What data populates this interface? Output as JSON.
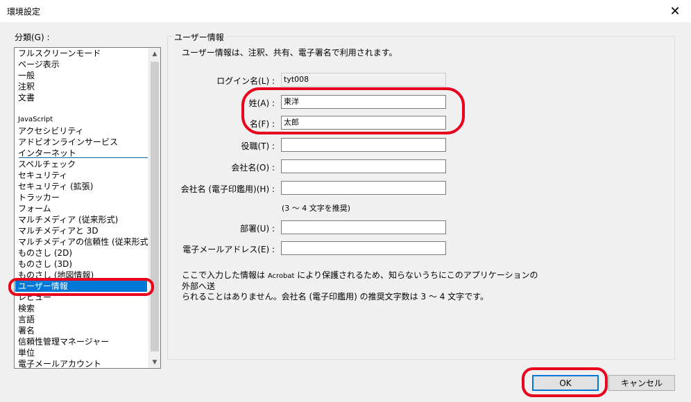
{
  "window": {
    "title": "環境設定",
    "close_glyph": "✕"
  },
  "category": {
    "label": "分類(G) :",
    "items": [
      {
        "label": "フルスクリーンモード",
        "small": false
      },
      {
        "label": "ページ表示",
        "small": false
      },
      {
        "label": "一般",
        "small": false
      },
      {
        "label": "注釈",
        "small": false
      },
      {
        "label": "文書",
        "small": false
      },
      {
        "label": "JavaScript",
        "small": true
      },
      {
        "label": "アクセシビリティ",
        "small": false
      },
      {
        "label": "アドビオンラインサービス",
        "small": false
      },
      {
        "label": "インターネット",
        "small": false
      },
      {
        "label": "スペルチェック",
        "small": false
      },
      {
        "label": "セキュリティ",
        "small": false
      },
      {
        "label": "セキュリティ (拡張)",
        "small": false
      },
      {
        "label": "トラッカー",
        "small": false
      },
      {
        "label": "フォーム",
        "small": false
      },
      {
        "label": "マルチメディア (従来形式)",
        "small": false
      },
      {
        "label": "マルチメディアと 3D",
        "small": false
      },
      {
        "label": "マルチメディアの信頼性 (従来形式)",
        "small": false
      },
      {
        "label": "ものさし (2D)",
        "small": false
      },
      {
        "label": "ものさし (3D)",
        "small": false
      },
      {
        "label": "ものさし (地図情報)",
        "small": false
      },
      {
        "label": "ユーザー情報",
        "small": false
      },
      {
        "label": "レビュー",
        "small": false
      },
      {
        "label": "検索",
        "small": false
      },
      {
        "label": "言語",
        "small": false
      },
      {
        "label": "署名",
        "small": false
      },
      {
        "label": "信頼性管理マネージャー",
        "small": false
      },
      {
        "label": "単位",
        "small": false
      },
      {
        "label": "電子メールアカウント",
        "small": false
      }
    ],
    "selected_index": 20
  },
  "user_info": {
    "group_title": "ユーザー情報",
    "description": "ユーザー情報は、注釈、共有、電子署名で利用されます。",
    "fields": [
      {
        "label": "ログイン名(L) :",
        "value": "tyt008",
        "readonly": true
      },
      {
        "label": "姓(A) :",
        "value": "東洋",
        "readonly": false
      },
      {
        "label": "名(F) :",
        "value": "太郎",
        "readonly": false
      },
      {
        "label": "役職(T) :",
        "value": "",
        "readonly": false
      },
      {
        "label": "会社名(O) :",
        "value": "",
        "readonly": false
      },
      {
        "label": "会社名 (電子印鑑用)(H) :",
        "value": "",
        "readonly": false
      },
      {
        "label": "部署(U) :",
        "value": "",
        "readonly": false
      },
      {
        "label": "電子メールアドレス(E) :",
        "value": "",
        "readonly": false
      }
    ],
    "hint": "(3 ～ 4 文字を推奨)",
    "note_line1_a": "ここで入力した情報は ",
    "note_line1_b": "Acrobat",
    "note_line1_c": " により保護されるため、知らないうちにこのアプリケーションの外部へ送",
    "note_line2": "られることはありません。会社名 (電子印鑑用) の推奨文字数は 3 ～ 4 文字です。"
  },
  "buttons": {
    "ok": "OK",
    "cancel": "キャンセル"
  },
  "colors": {
    "selection": "#0078d7",
    "annotation": "#e8001c",
    "default_button_border": "#0078d7"
  }
}
